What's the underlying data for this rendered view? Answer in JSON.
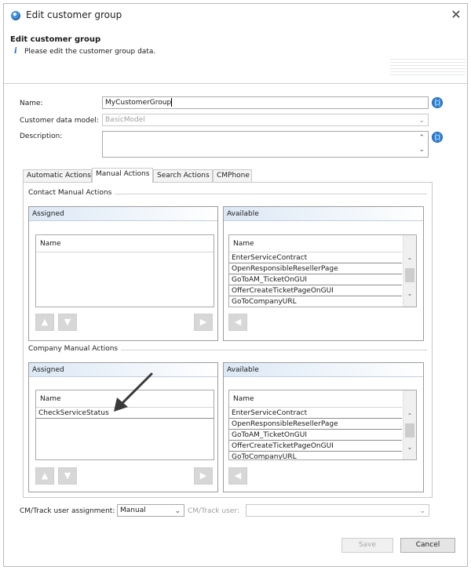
{
  "window": {
    "title": "Edit customer group",
    "close_glyph": "✕",
    "icon": "globe-icon"
  },
  "banner": {
    "title": "Edit customer group",
    "info_glyph": "i",
    "message": "Please edit the customer group data."
  },
  "form": {
    "name_label": "Name:",
    "name_value": "MyCustomerGroup",
    "model_label": "Customer data model:",
    "model_value": "BasicModel",
    "description_label": "Description:",
    "description_value": ""
  },
  "tabs": [
    {
      "label": "Automatic Actions",
      "active": false
    },
    {
      "label": "Manual Actions",
      "active": true
    },
    {
      "label": "Search Actions",
      "active": false
    },
    {
      "label": "CMPhone",
      "active": false
    }
  ],
  "contact": {
    "group_title": "Contact Manual Actions",
    "assigned_title": "Assigned",
    "available_title": "Available",
    "assigned_col": "Name",
    "assigned_items": [],
    "available_col": "Name",
    "available_items": [
      "EnterServiceContract",
      "OpenResponsibleResellerPage",
      "GoToAM_TicketOnGUI",
      "OfferCreateTicketPageOnGUI",
      "GoToCompanyURL"
    ]
  },
  "company": {
    "group_title": "Company Manual Actions",
    "assigned_title": "Assigned",
    "available_title": "Available",
    "assigned_col": "Name",
    "assigned_items": [
      "CheckServiceStatus"
    ],
    "available_col": "Name",
    "available_items": [
      "EnterServiceContract",
      "OpenResponsibleResellerPage",
      "GoToAM_TicketOnGUI",
      "OfferCreateTicketPageOnGUI",
      "GoToCompanyURL"
    ]
  },
  "footer": {
    "assignment_label": "CM/Track user assignment:",
    "assignment_value": "Manual",
    "user_label": "CM/Track user:",
    "user_value": "",
    "save_label": "Save",
    "cancel_label": "Cancel"
  },
  "glyphs": {
    "up": "▲",
    "down": "▼",
    "right": "▶",
    "left": "◀",
    "chevron": "⌵"
  },
  "colors": {
    "accent": "#2b6fc2",
    "panel_head": "#dce8f5"
  }
}
